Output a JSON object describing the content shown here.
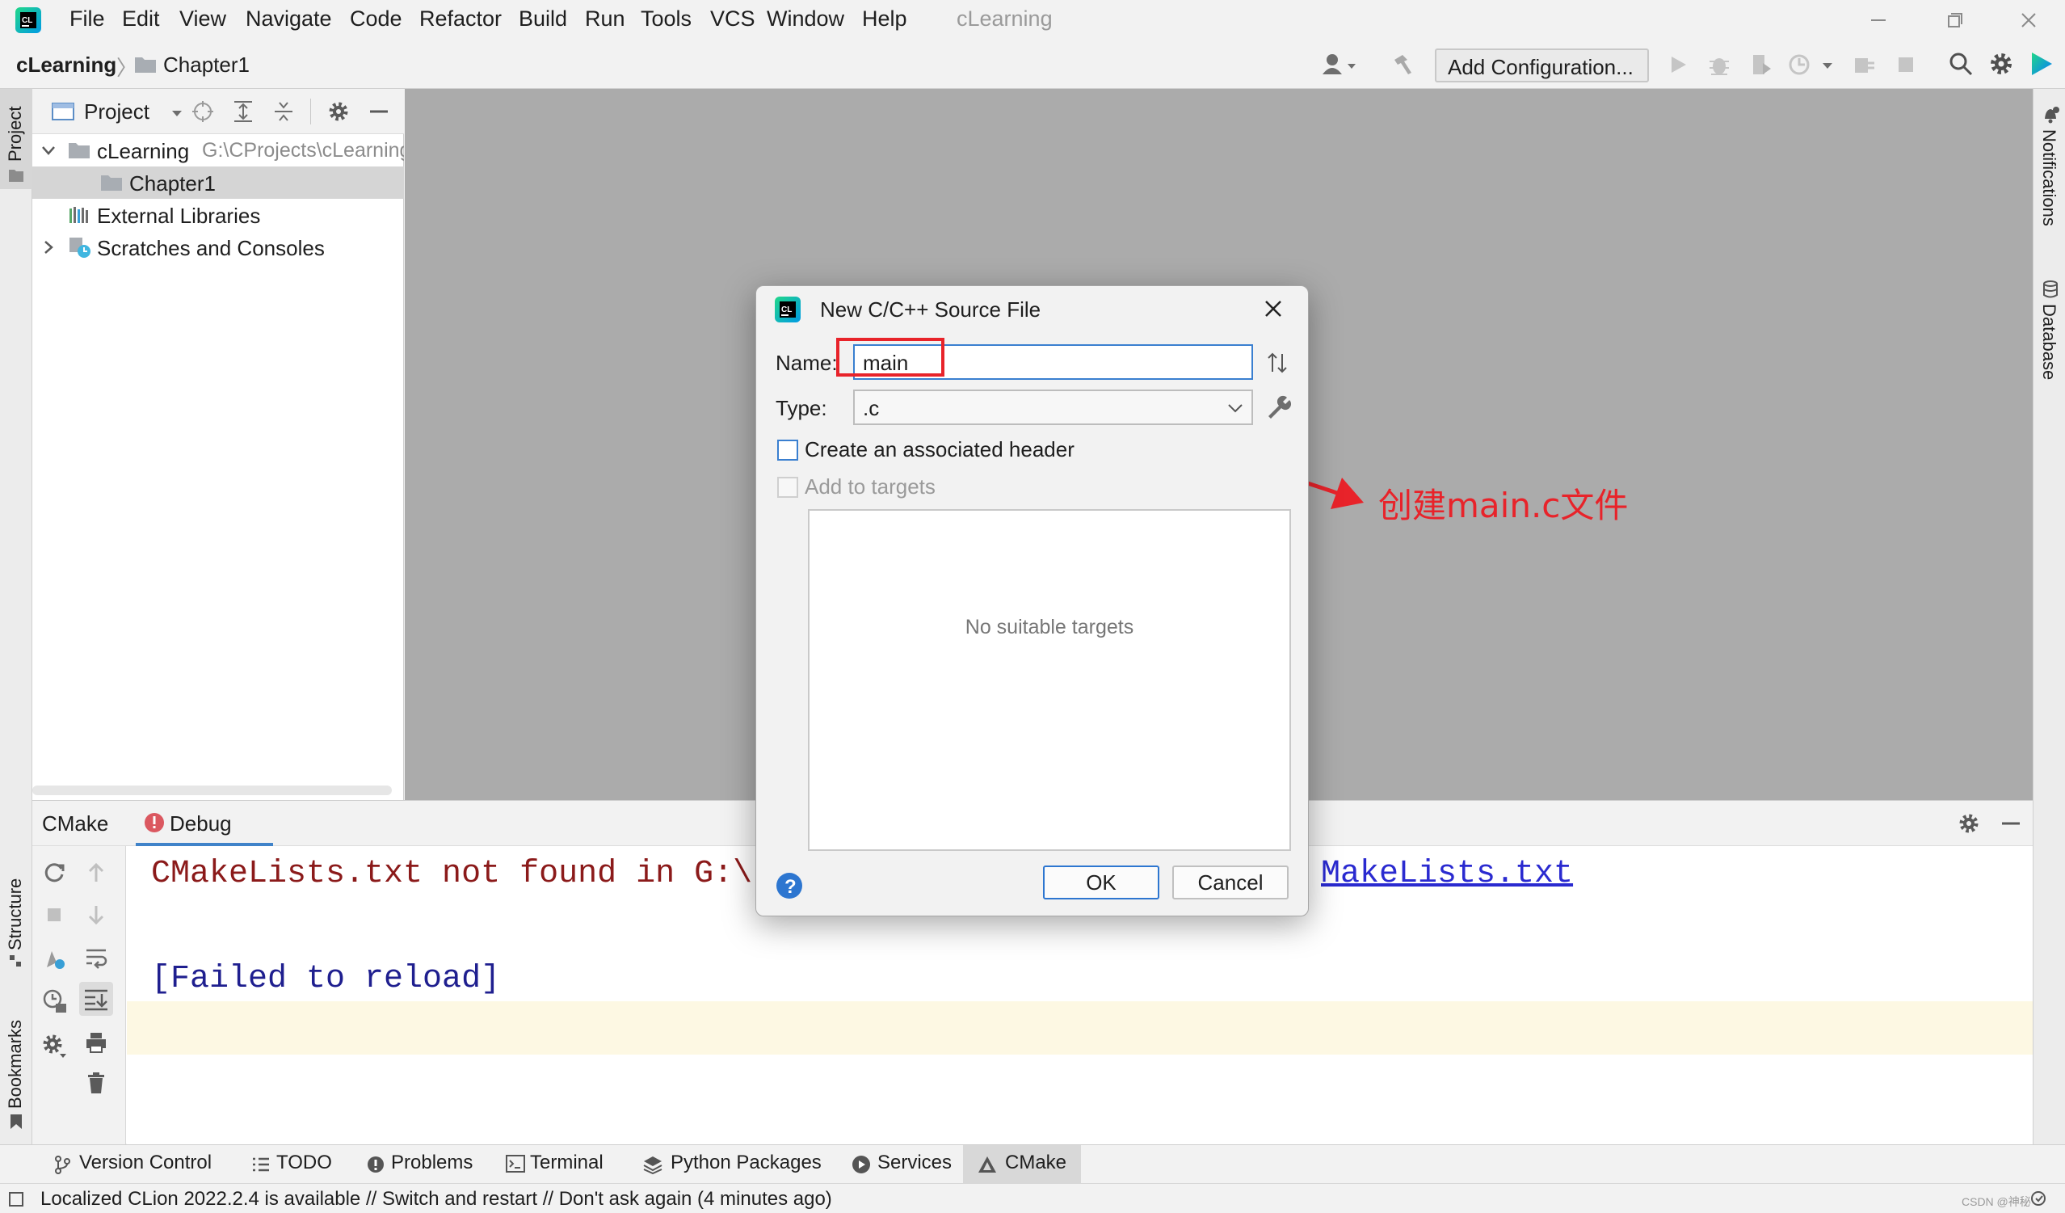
{
  "menubar": {
    "items": [
      "File",
      "Edit",
      "View",
      "Navigate",
      "Code",
      "Refactor",
      "Build",
      "Run",
      "Tools",
      "VCS",
      "Window",
      "Help"
    ],
    "window_title": "cLearning"
  },
  "navbar": {
    "project": "cLearning",
    "folder": "Chapter1",
    "add_config": "Add Configuration..."
  },
  "side": {
    "left_project": "Project",
    "left_structure": "Structure",
    "left_bookmarks": "Bookmarks",
    "right_notifications": "Notifications",
    "right_database": "Database"
  },
  "project_panel": {
    "title": "Project",
    "tree": {
      "root_name": "cLearning",
      "root_path": "G:\\CProjects\\cLearning",
      "child": "Chapter1",
      "libs": "External Libraries",
      "scratches": "Scratches and Consoles"
    }
  },
  "bottom_panel": {
    "tab_cmake": "CMake",
    "tab_debug": "Debug",
    "console_line1_a": "CMakeLists.txt not found in G:\\",
    "console_line1_link": "MakeLists.txt",
    "console_line2": "[Failed to reload]"
  },
  "toolwindows": [
    "Version Control",
    "TODO",
    "Problems",
    "Terminal",
    "Python Packages",
    "Services",
    "CMake"
  ],
  "status": {
    "message": "Localized CLion 2022.2.4 is available // Switch and restart // Don't ask again (4 minutes ago)",
    "watermark": "CSDN @神秘"
  },
  "dialog": {
    "title": "New C/C++ Source File",
    "name_label": "Name:",
    "name_value": "main",
    "type_label": "Type:",
    "type_value": ".c",
    "header_checkbox": "Create an associated header",
    "targets_checkbox": "Add to targets",
    "no_targets": "No suitable targets",
    "ok": "OK",
    "cancel": "Cancel"
  },
  "annotation": {
    "text": "创建main.c文件",
    "color": "#e8232a"
  }
}
